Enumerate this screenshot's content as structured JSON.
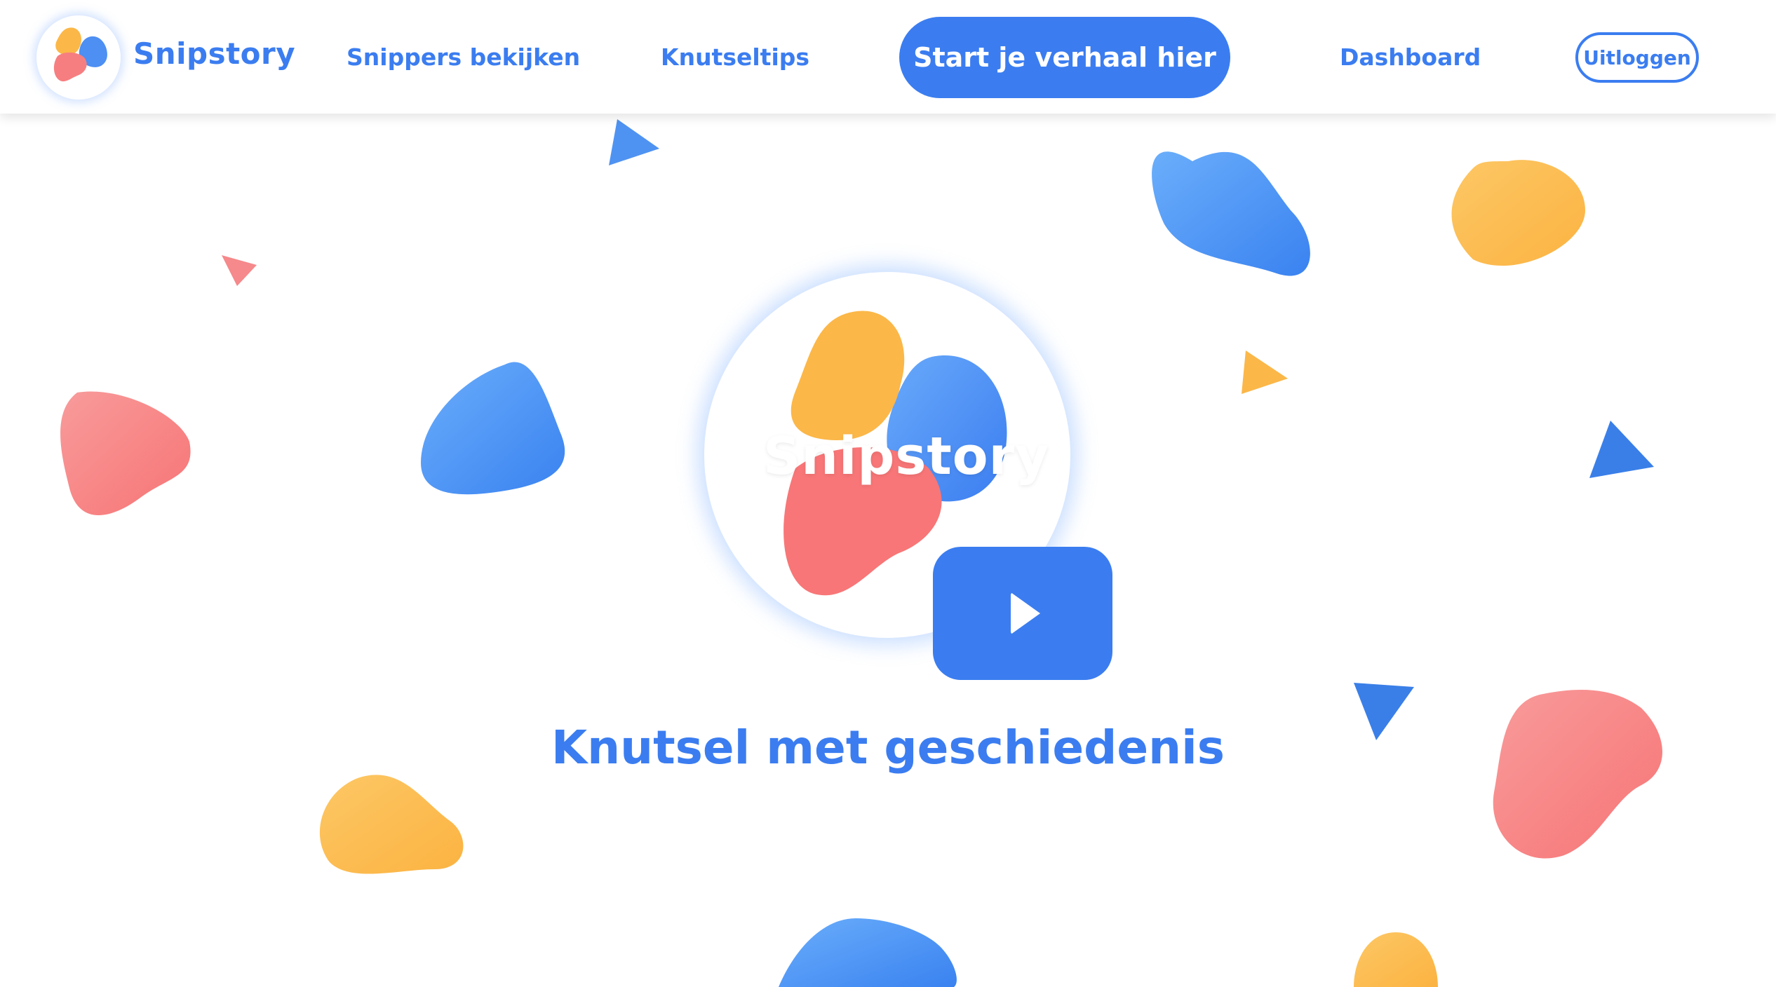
{
  "header": {
    "brand": "Snipstory",
    "nav": {
      "snippers": "Snippers bekijken",
      "knutseltips": "Knutseltips",
      "start": "Start je verhaal hier",
      "dashboard": "Dashboard",
      "logout": "Uitloggen"
    }
  },
  "hero": {
    "logo_word": "Snipstory",
    "play_icon": "play-icon",
    "tagline": "Knutsel met geschiedenis"
  },
  "colors": {
    "blue": "#3b7df0",
    "light_blue": "#5aa0f5",
    "orange": "#fdbd52",
    "red": "#f87f82",
    "white": "#ffffff"
  }
}
